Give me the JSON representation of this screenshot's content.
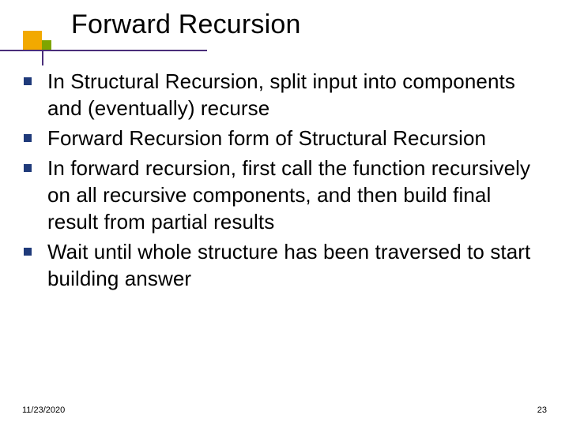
{
  "slide": {
    "title": "Forward Recursion",
    "bullets": [
      "In Structural Recursion, split input into components and (eventually) recurse",
      "Forward Recursion form of Structural Recursion",
      "In forward recursion, first call the function recursively on all recursive components, and then build final result from partial results",
      "Wait until whole structure has been traversed to start building answer"
    ]
  },
  "footer": {
    "date": "11/23/2020",
    "page": "23"
  },
  "colors": {
    "accent_square_orange": "#f2a900",
    "accent_square_green": "#7ea500",
    "title_rule": "#4a2e7a",
    "bullet": "#1f3a7a"
  }
}
